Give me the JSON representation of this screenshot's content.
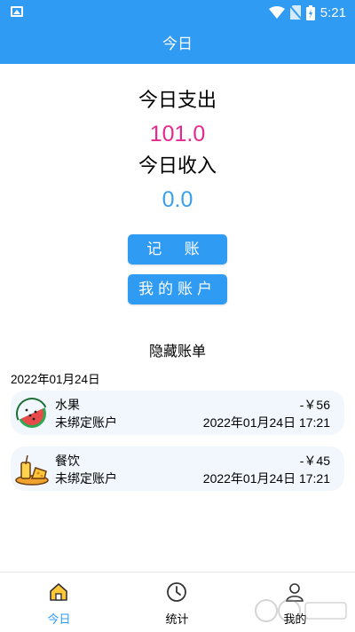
{
  "status_bar": {
    "time": "5:21"
  },
  "app_bar": {
    "title": "今日"
  },
  "summary": {
    "expense_label": "今日支出",
    "expense_value": "101.0",
    "income_label": "今日收入",
    "income_value": "0.0"
  },
  "buttons": {
    "record": "记 账",
    "my_account": "我的账户"
  },
  "hidden_bills_label": "隐藏账单",
  "date_header": "2022年01月24日",
  "records": [
    {
      "icon": "watermelon-icon",
      "category": "水果",
      "account": "未绑定账户",
      "amount": "-￥56",
      "time": "2022年01月24日 17:21"
    },
    {
      "icon": "meal-icon",
      "category": "餐饮",
      "account": "未绑定账户",
      "amount": "-￥45",
      "time": "2022年01月24日 17:21"
    }
  ],
  "tabs": [
    {
      "label": "今日",
      "icon": "home-icon",
      "active": true
    },
    {
      "label": "统计",
      "icon": "clock-icon",
      "active": false
    },
    {
      "label": "我的",
      "icon": "user-icon",
      "active": false
    }
  ],
  "colors": {
    "primary": "#2f9bf3",
    "expense": "#e5298e",
    "income": "#3aa0ec",
    "active_tab": "#2f9bf3"
  }
}
